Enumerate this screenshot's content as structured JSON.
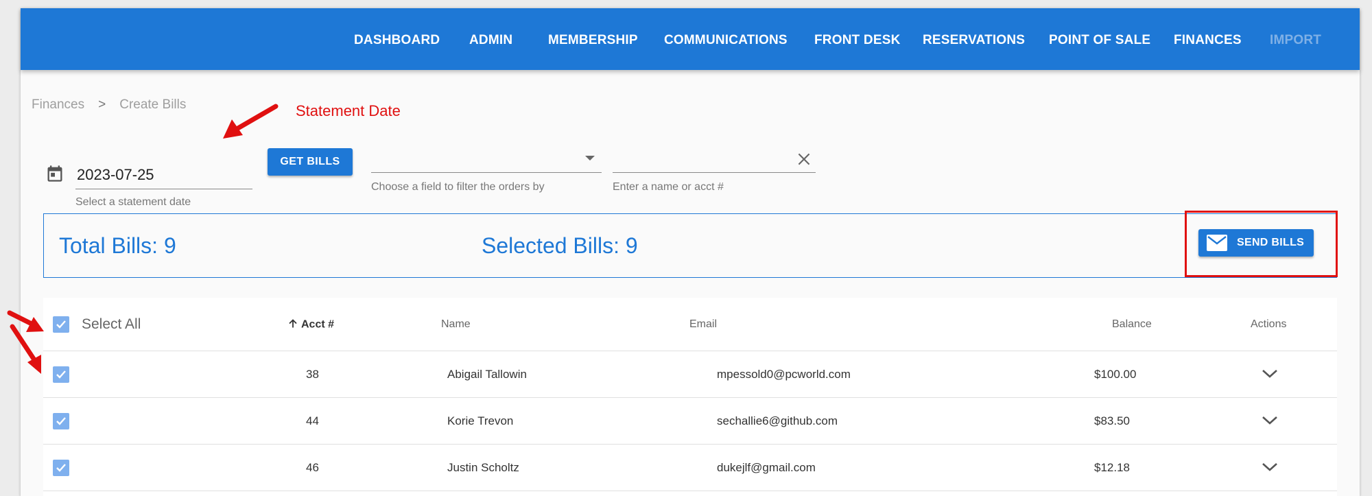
{
  "nav": {
    "items": [
      {
        "label": "DASHBOARD"
      },
      {
        "label": "ADMIN"
      },
      {
        "label": "MEMBERSHIP"
      },
      {
        "label": "COMMUNICATIONS"
      },
      {
        "label": "FRONT DESK"
      },
      {
        "label": "RESERVATIONS"
      },
      {
        "label": "POINT OF SALE"
      },
      {
        "label": "FINANCES"
      },
      {
        "label": "IMPORT"
      }
    ]
  },
  "breadcrumb": {
    "parent": "Finances",
    "separator": ">",
    "current": "Create Bills"
  },
  "annotation": {
    "label": "Statement Date"
  },
  "filters": {
    "date_value": "2023-07-25",
    "date_hint": "Select a statement date",
    "get_bills_label": "GET BILLS",
    "filter_select_hint": "Choose a field to filter the orders by",
    "search_value": "",
    "search_hint": "Enter a name or acct #"
  },
  "summary": {
    "total_label": "Total Bills: 9",
    "selected_label": "Selected Bills: 9",
    "send_bills_label": "SEND BILLS"
  },
  "table": {
    "select_all_label": "Select All",
    "columns": {
      "acct": "Acct #",
      "name": "Name",
      "email": "Email",
      "balance": "Balance",
      "actions": "Actions"
    },
    "rows": [
      {
        "acct": "38",
        "name": "Abigail Tallowin",
        "email": "mpessold0@pcworld.com",
        "balance": "$100.00",
        "selected": true
      },
      {
        "acct": "44",
        "name": "Korie Trevon",
        "email": "sechallie6@github.com",
        "balance": "$83.50",
        "selected": true
      },
      {
        "acct": "46",
        "name": "Justin Scholtz",
        "email": "dukejlf@gmail.com",
        "balance": "$12.18",
        "selected": true
      }
    ]
  },
  "colors": {
    "primary": "#1e78d6",
    "annotation_red": "#e01010",
    "checkbox": "#7fb0ee"
  }
}
